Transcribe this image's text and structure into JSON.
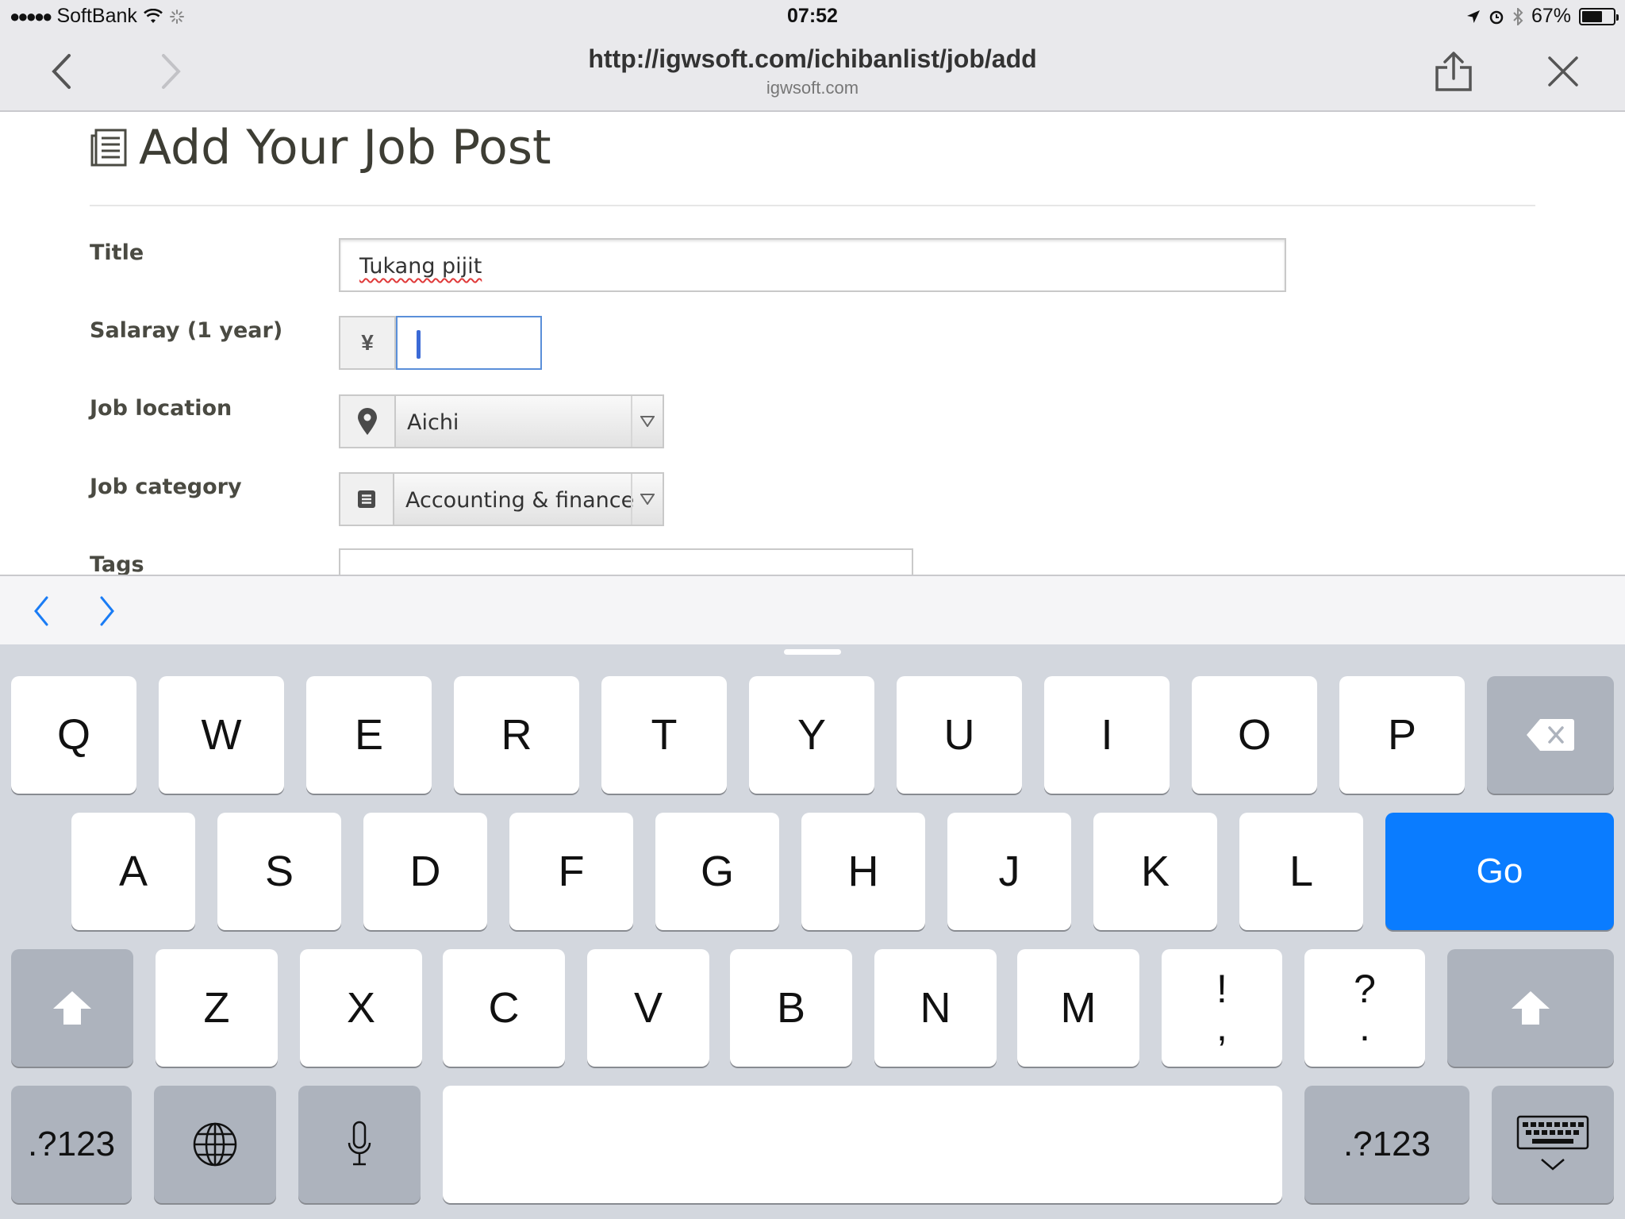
{
  "status_bar": {
    "carrier": "SoftBank",
    "time": "07:52",
    "battery": "67%",
    "battery_level": 0.67
  },
  "nav": {
    "url": "http://igwsoft.com/ichibanlist/job/add",
    "domain": "igwsoft.com"
  },
  "page": {
    "title": "Add Your Job Post",
    "fields": {
      "title_label": "Title",
      "title_value": "Tukang pijit",
      "salary_label": "Salaray (1 year)",
      "salary_currency": "¥",
      "location_label": "Job location",
      "location_value": "Aichi",
      "category_label": "Job category",
      "category_value": "Accounting & finance",
      "tags_label": "Tags"
    }
  },
  "keyboard": {
    "row1": [
      "Q",
      "W",
      "E",
      "R",
      "T",
      "Y",
      "U",
      "I",
      "O",
      "P"
    ],
    "row2": [
      "A",
      "S",
      "D",
      "F",
      "G",
      "H",
      "J",
      "K",
      "L"
    ],
    "row3": [
      "Z",
      "X",
      "C",
      "V",
      "B",
      "N",
      "M"
    ],
    "punct1_top": "!",
    "punct1_bottom": ",",
    "punct2_top": "?",
    "punct2_bottom": ".",
    "go_label": "Go",
    "numbers_label": ".?123"
  }
}
